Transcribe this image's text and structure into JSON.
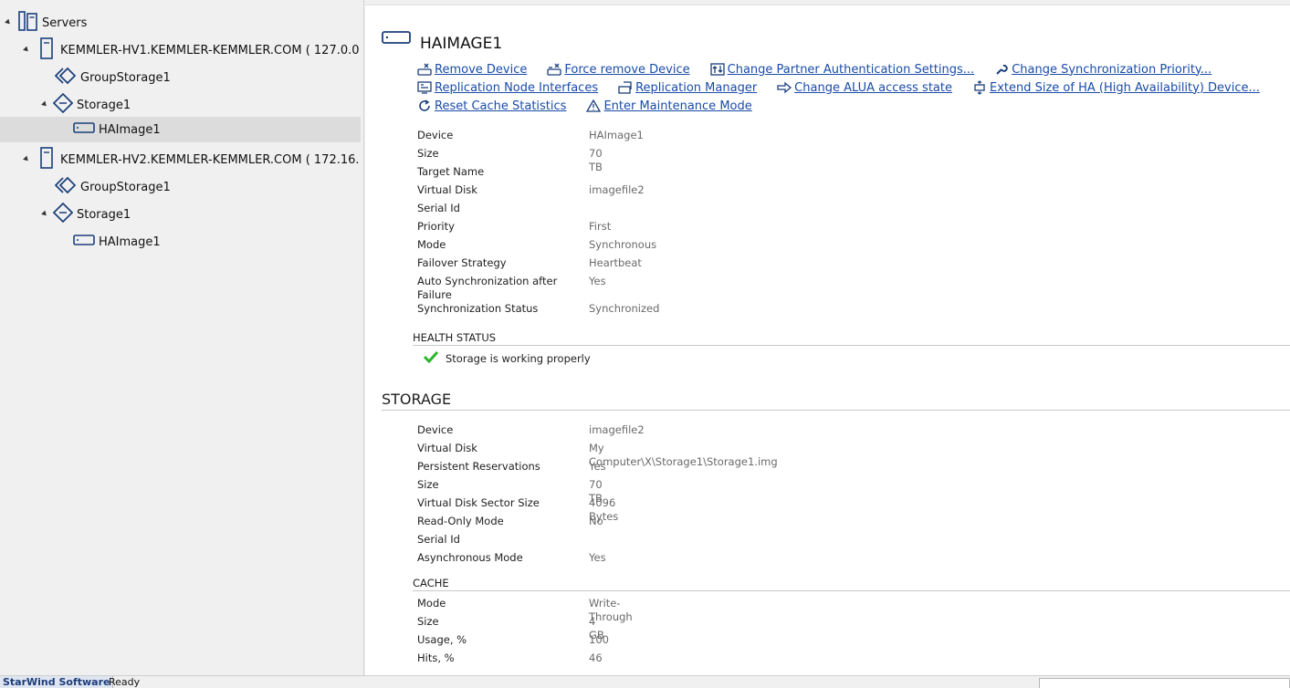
{
  "tree": {
    "root": {
      "label": "Servers",
      "icon": "servers-icon"
    },
    "servers": [
      {
        "label": "KEMMLER-HV1.KEMMLER-KEMMLER.COM ( 127.0.0",
        "children": [
          {
            "label": "GroupStorage1",
            "icon": "group-storage-icon"
          },
          {
            "label": "Storage1",
            "icon": "storage-icon",
            "children": [
              {
                "label": "HAImage1",
                "icon": "device-icon",
                "selected": true
              }
            ]
          }
        ]
      },
      {
        "label": "KEMMLER-HV2.KEMMLER-KEMMLER.COM ( 172.16.",
        "children": [
          {
            "label": "GroupStorage1",
            "icon": "group-storage-icon"
          },
          {
            "label": "Storage1",
            "icon": "storage-icon",
            "children": [
              {
                "label": "HAImage1",
                "icon": "device-icon",
                "selected": false
              }
            ]
          }
        ]
      }
    ]
  },
  "device": {
    "title": "HAIMAGE1",
    "actions": {
      "row1": [
        {
          "label": "Remove Device",
          "icon": "remove-device-icon"
        },
        {
          "label": "Force remove Device",
          "icon": "force-remove-icon"
        },
        {
          "label": "Change Partner Authentication Settings...",
          "icon": "auth-settings-icon"
        },
        {
          "label": "Change Synchronization Priority...",
          "icon": "wrench-icon"
        }
      ],
      "row2": [
        {
          "label": "Replication Node Interfaces",
          "icon": "node-interfaces-icon"
        },
        {
          "label": "Replication Manager",
          "icon": "replication-manager-icon"
        },
        {
          "label": "Change ALUA access state",
          "icon": "arrow-right-icon"
        },
        {
          "label": "Extend Size of HA (High Availability) Device...",
          "icon": "extend-size-icon"
        }
      ],
      "row3": [
        {
          "label": "Reset Cache Statistics",
          "icon": "refresh-icon"
        },
        {
          "label": "Enter Maintenance Mode",
          "icon": "warning-icon"
        }
      ]
    },
    "properties": [
      {
        "name": "Device",
        "value": "HAImage1"
      },
      {
        "name": "Size",
        "value": "70 TB"
      },
      {
        "name": "Target Name",
        "value": ""
      },
      {
        "name": "Virtual Disk",
        "value": "imagefile2"
      },
      {
        "name": "Serial Id",
        "value": ""
      },
      {
        "name": "Priority",
        "value": "First"
      },
      {
        "name": "Mode",
        "value": "Synchronous"
      },
      {
        "name": "Failover Strategy",
        "value": "Heartbeat"
      },
      {
        "name": "Auto Synchronization after Failure",
        "value": "Yes"
      },
      {
        "name": "Synchronization Status",
        "value": "Synchronized"
      }
    ],
    "health": {
      "heading": "HEALTH STATUS",
      "message": "Storage is working properly",
      "color": "#2bb52b"
    }
  },
  "storage": {
    "heading": "STORAGE",
    "properties": [
      {
        "name": "Device",
        "value": "imagefile2"
      },
      {
        "name": "Virtual Disk",
        "value": "My Computer\\X\\Storage1\\Storage1.img"
      },
      {
        "name": "Persistent Reservations",
        "value": "Yes"
      },
      {
        "name": "Size",
        "value": "70 TB"
      },
      {
        "name": "Virtual Disk Sector Size",
        "value": "4096 Bytes"
      },
      {
        "name": "Read-Only Mode",
        "value": "No"
      },
      {
        "name": "Serial Id",
        "value": ""
      },
      {
        "name": "Asynchronous Mode",
        "value": "Yes"
      }
    ],
    "cache": {
      "heading": "CACHE",
      "properties": [
        {
          "name": "Mode",
          "value": "Write-Through"
        },
        {
          "name": "Size",
          "value": "4 GB"
        },
        {
          "name": "Usage, %",
          "value": "100"
        },
        {
          "name": "Hits, %",
          "value": "46"
        }
      ]
    }
  },
  "statusbar": {
    "brand": "StarWind Software",
    "status": "Ready"
  },
  "colors": {
    "link": "#1a4ba8",
    "icon_blue": "#1a3f7a",
    "selection": "#dcdcdc"
  }
}
